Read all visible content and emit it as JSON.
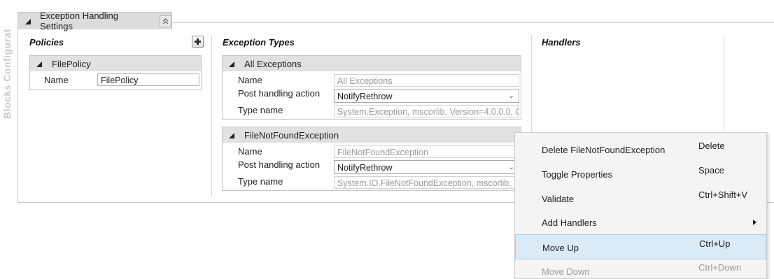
{
  "sidebar": {
    "label": "Blocks Configurat"
  },
  "section": {
    "title": "Exception Handling Settings",
    "collapse_icon": "double-chevron-up-icon"
  },
  "columns": {
    "policies": "Policies",
    "exception_types": "Exception Types",
    "handlers": "Handlers"
  },
  "policies": [
    {
      "name": "FilePolicy",
      "props": {
        "name_label": "Name",
        "name_value": "FilePolicy"
      }
    }
  ],
  "exception_types": [
    {
      "title": "All Exceptions",
      "name_label": "Name",
      "name_value": "All Exceptions",
      "action_label": "Post handling action",
      "action_value": "NotifyRethrow",
      "type_label": "Type name",
      "type_value": "System.Exception, mscorlib, Version=4.0.0.0, C"
    },
    {
      "title": "FileNotFoundException",
      "name_label": "Name",
      "name_value": "FileNotFoundException",
      "action_label": "Post handling action",
      "action_value": "NotifyRethrow",
      "type_label": "Type name",
      "type_value": "System.IO.FileNotFoundException, mscorlib,"
    }
  ],
  "context_menu": [
    {
      "label": "Delete FileNotFoundException",
      "shortcut": "Delete"
    },
    {
      "label": "Toggle Properties",
      "shortcut": "Space"
    },
    {
      "label": "Validate",
      "shortcut": "Ctrl+Shift+V"
    },
    {
      "label": "Add Handlers",
      "shortcut": ""
    },
    {
      "label": "Move Up",
      "shortcut": "Ctrl+Up"
    },
    {
      "label": "Move Down",
      "shortcut": "Ctrl+Down"
    }
  ],
  "colors": {
    "highlight": "#dbeaf7",
    "header": "#e1e1e1",
    "disabled_text": "#9b9b9b"
  }
}
